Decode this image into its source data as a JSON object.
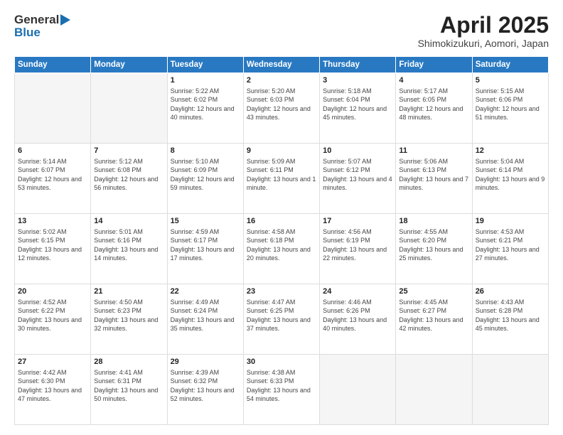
{
  "logo": {
    "line1": "General",
    "line2": "Blue"
  },
  "title": "April 2025",
  "subtitle": "Shimokizukuri, Aomori, Japan",
  "days_of_week": [
    "Sunday",
    "Monday",
    "Tuesday",
    "Wednesday",
    "Thursday",
    "Friday",
    "Saturday"
  ],
  "weeks": [
    [
      {
        "day": "",
        "sunrise": "",
        "sunset": "",
        "daylight": "",
        "empty": true
      },
      {
        "day": "",
        "sunrise": "",
        "sunset": "",
        "daylight": "",
        "empty": true
      },
      {
        "day": "1",
        "sunrise": "Sunrise: 5:22 AM",
        "sunset": "Sunset: 6:02 PM",
        "daylight": "Daylight: 12 hours and 40 minutes."
      },
      {
        "day": "2",
        "sunrise": "Sunrise: 5:20 AM",
        "sunset": "Sunset: 6:03 PM",
        "daylight": "Daylight: 12 hours and 43 minutes."
      },
      {
        "day": "3",
        "sunrise": "Sunrise: 5:18 AM",
        "sunset": "Sunset: 6:04 PM",
        "daylight": "Daylight: 12 hours and 45 minutes."
      },
      {
        "day": "4",
        "sunrise": "Sunrise: 5:17 AM",
        "sunset": "Sunset: 6:05 PM",
        "daylight": "Daylight: 12 hours and 48 minutes."
      },
      {
        "day": "5",
        "sunrise": "Sunrise: 5:15 AM",
        "sunset": "Sunset: 6:06 PM",
        "daylight": "Daylight: 12 hours and 51 minutes."
      }
    ],
    [
      {
        "day": "6",
        "sunrise": "Sunrise: 5:14 AM",
        "sunset": "Sunset: 6:07 PM",
        "daylight": "Daylight: 12 hours and 53 minutes."
      },
      {
        "day": "7",
        "sunrise": "Sunrise: 5:12 AM",
        "sunset": "Sunset: 6:08 PM",
        "daylight": "Daylight: 12 hours and 56 minutes."
      },
      {
        "day": "8",
        "sunrise": "Sunrise: 5:10 AM",
        "sunset": "Sunset: 6:09 PM",
        "daylight": "Daylight: 12 hours and 59 minutes."
      },
      {
        "day": "9",
        "sunrise": "Sunrise: 5:09 AM",
        "sunset": "Sunset: 6:11 PM",
        "daylight": "Daylight: 13 hours and 1 minute."
      },
      {
        "day": "10",
        "sunrise": "Sunrise: 5:07 AM",
        "sunset": "Sunset: 6:12 PM",
        "daylight": "Daylight: 13 hours and 4 minutes."
      },
      {
        "day": "11",
        "sunrise": "Sunrise: 5:06 AM",
        "sunset": "Sunset: 6:13 PM",
        "daylight": "Daylight: 13 hours and 7 minutes."
      },
      {
        "day": "12",
        "sunrise": "Sunrise: 5:04 AM",
        "sunset": "Sunset: 6:14 PM",
        "daylight": "Daylight: 13 hours and 9 minutes."
      }
    ],
    [
      {
        "day": "13",
        "sunrise": "Sunrise: 5:02 AM",
        "sunset": "Sunset: 6:15 PM",
        "daylight": "Daylight: 13 hours and 12 minutes."
      },
      {
        "day": "14",
        "sunrise": "Sunrise: 5:01 AM",
        "sunset": "Sunset: 6:16 PM",
        "daylight": "Daylight: 13 hours and 14 minutes."
      },
      {
        "day": "15",
        "sunrise": "Sunrise: 4:59 AM",
        "sunset": "Sunset: 6:17 PM",
        "daylight": "Daylight: 13 hours and 17 minutes."
      },
      {
        "day": "16",
        "sunrise": "Sunrise: 4:58 AM",
        "sunset": "Sunset: 6:18 PM",
        "daylight": "Daylight: 13 hours and 20 minutes."
      },
      {
        "day": "17",
        "sunrise": "Sunrise: 4:56 AM",
        "sunset": "Sunset: 6:19 PM",
        "daylight": "Daylight: 13 hours and 22 minutes."
      },
      {
        "day": "18",
        "sunrise": "Sunrise: 4:55 AM",
        "sunset": "Sunset: 6:20 PM",
        "daylight": "Daylight: 13 hours and 25 minutes."
      },
      {
        "day": "19",
        "sunrise": "Sunrise: 4:53 AM",
        "sunset": "Sunset: 6:21 PM",
        "daylight": "Daylight: 13 hours and 27 minutes."
      }
    ],
    [
      {
        "day": "20",
        "sunrise": "Sunrise: 4:52 AM",
        "sunset": "Sunset: 6:22 PM",
        "daylight": "Daylight: 13 hours and 30 minutes."
      },
      {
        "day": "21",
        "sunrise": "Sunrise: 4:50 AM",
        "sunset": "Sunset: 6:23 PM",
        "daylight": "Daylight: 13 hours and 32 minutes."
      },
      {
        "day": "22",
        "sunrise": "Sunrise: 4:49 AM",
        "sunset": "Sunset: 6:24 PM",
        "daylight": "Daylight: 13 hours and 35 minutes."
      },
      {
        "day": "23",
        "sunrise": "Sunrise: 4:47 AM",
        "sunset": "Sunset: 6:25 PM",
        "daylight": "Daylight: 13 hours and 37 minutes."
      },
      {
        "day": "24",
        "sunrise": "Sunrise: 4:46 AM",
        "sunset": "Sunset: 6:26 PM",
        "daylight": "Daylight: 13 hours and 40 minutes."
      },
      {
        "day": "25",
        "sunrise": "Sunrise: 4:45 AM",
        "sunset": "Sunset: 6:27 PM",
        "daylight": "Daylight: 13 hours and 42 minutes."
      },
      {
        "day": "26",
        "sunrise": "Sunrise: 4:43 AM",
        "sunset": "Sunset: 6:28 PM",
        "daylight": "Daylight: 13 hours and 45 minutes."
      }
    ],
    [
      {
        "day": "27",
        "sunrise": "Sunrise: 4:42 AM",
        "sunset": "Sunset: 6:30 PM",
        "daylight": "Daylight: 13 hours and 47 minutes."
      },
      {
        "day": "28",
        "sunrise": "Sunrise: 4:41 AM",
        "sunset": "Sunset: 6:31 PM",
        "daylight": "Daylight: 13 hours and 50 minutes."
      },
      {
        "day": "29",
        "sunrise": "Sunrise: 4:39 AM",
        "sunset": "Sunset: 6:32 PM",
        "daylight": "Daylight: 13 hours and 52 minutes."
      },
      {
        "day": "30",
        "sunrise": "Sunrise: 4:38 AM",
        "sunset": "Sunset: 6:33 PM",
        "daylight": "Daylight: 13 hours and 54 minutes."
      },
      {
        "day": "",
        "sunrise": "",
        "sunset": "",
        "daylight": "",
        "empty": true
      },
      {
        "day": "",
        "sunrise": "",
        "sunset": "",
        "daylight": "",
        "empty": true
      },
      {
        "day": "",
        "sunrise": "",
        "sunset": "",
        "daylight": "",
        "empty": true
      }
    ]
  ]
}
